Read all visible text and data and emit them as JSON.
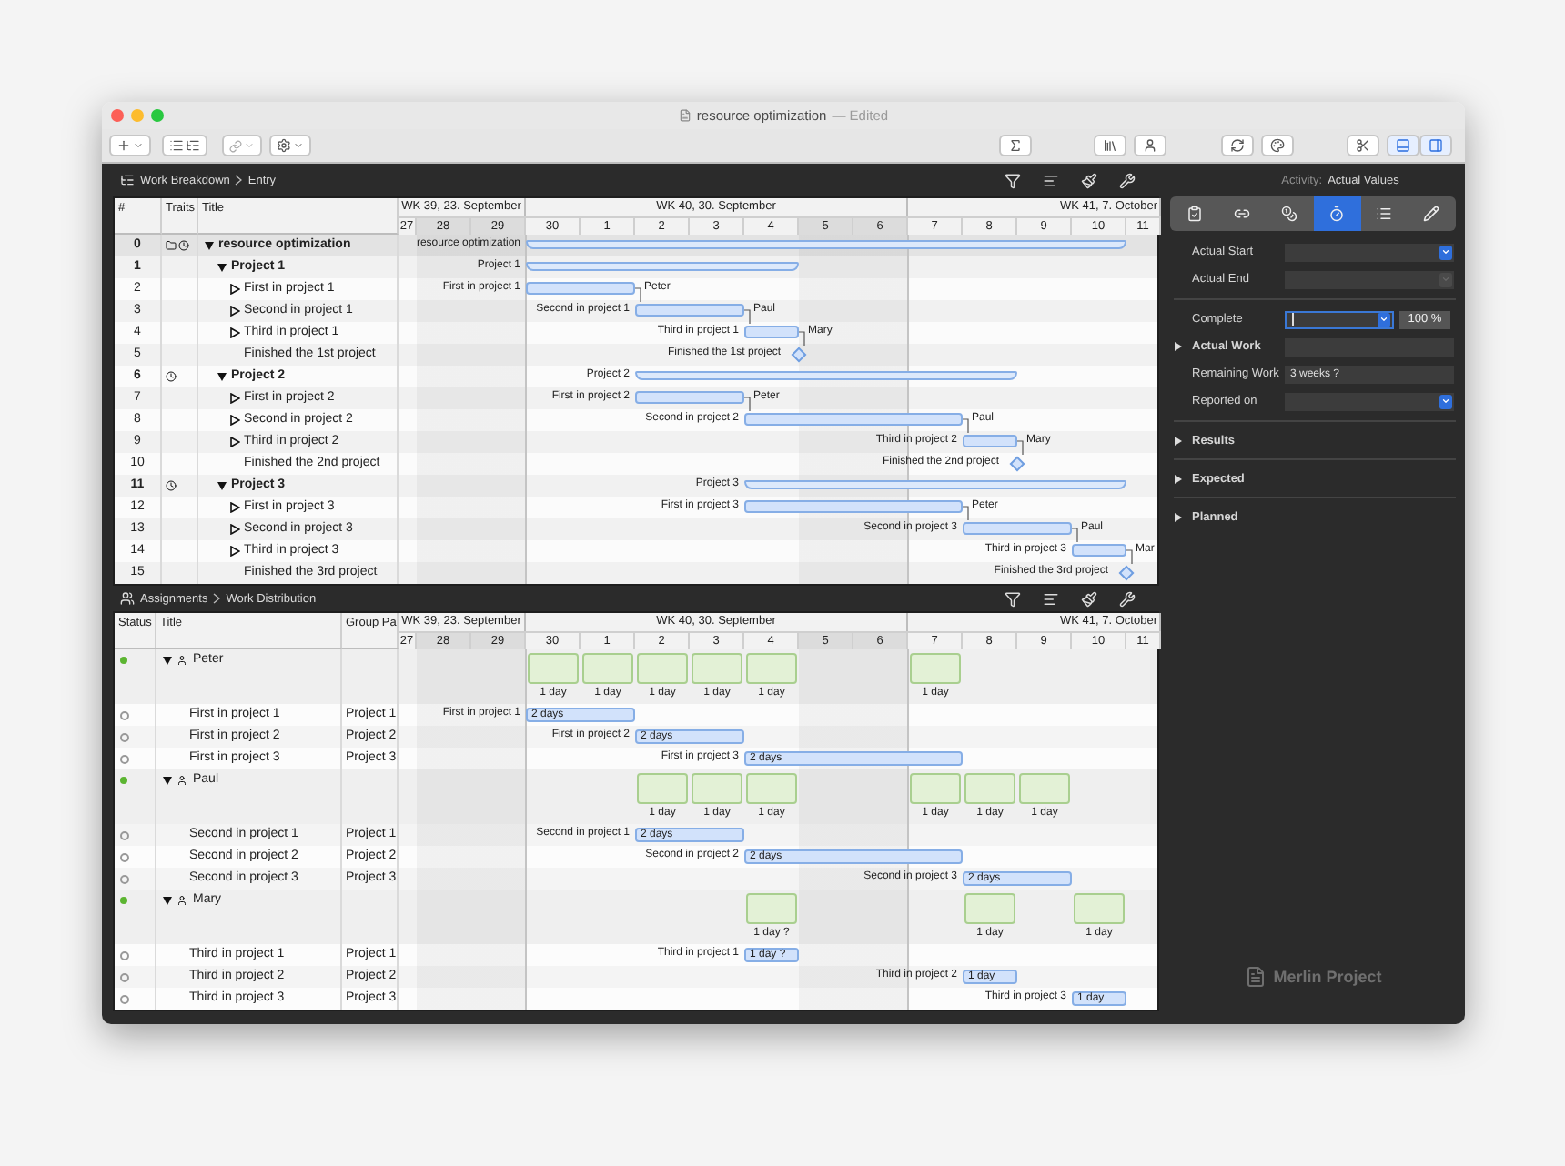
{
  "window": {
    "title": "resource optimization",
    "status": "— Edited"
  },
  "toolbar": {
    "view_toggles": [
      {
        "selected": true
      },
      {
        "selected": true
      }
    ]
  },
  "work_breakdown": {
    "breadcrumb": [
      "Work Breakdown",
      "Entry"
    ],
    "columns": [
      "#",
      "Traits",
      "Title"
    ],
    "weeks": [
      "WK 39, 23. September",
      "WK 40, 30. September",
      "WK 41, 7. October"
    ],
    "days": [
      {
        "label": "27",
        "weekend": false
      },
      {
        "label": "28",
        "weekend": true
      },
      {
        "label": "29",
        "weekend": true
      },
      {
        "label": "30",
        "weekend": false
      },
      {
        "label": "1",
        "weekend": false
      },
      {
        "label": "2",
        "weekend": false
      },
      {
        "label": "3",
        "weekend": false
      },
      {
        "label": "4",
        "weekend": false
      },
      {
        "label": "5",
        "weekend": true
      },
      {
        "label": "6",
        "weekend": true
      },
      {
        "label": "7",
        "weekend": false
      },
      {
        "label": "8",
        "weekend": false
      },
      {
        "label": "9",
        "weekend": false
      },
      {
        "label": "10",
        "weekend": false
      },
      {
        "label": "11",
        "weekend": false
      }
    ],
    "rows": [
      {
        "number": "0",
        "title": "resource optimization",
        "kind": "summary",
        "expanded": true,
        "calendar_trait": true,
        "clock_trait": true,
        "bar_label": "resource optimization",
        "children": [
          {
            "number": "1",
            "title": "Project 1",
            "kind": "summary",
            "expanded": true,
            "calendar_trait": false,
            "clock_trait": false,
            "bar_label": "Project 1",
            "children": [
              {
                "number": "2",
                "title": "First in project 1",
                "kind": "task",
                "expanded": false,
                "bar_label": "First in project 1",
                "resource": "Peter"
              },
              {
                "number": "3",
                "title": "Second in project 1",
                "kind": "task",
                "expanded": false,
                "bar_label": "Second in project 1",
                "resource": "Paul"
              },
              {
                "number": "4",
                "title": "Third in project 1",
                "kind": "task",
                "expanded": false,
                "bar_label": "Third in project 1",
                "resource": "Mary"
              },
              {
                "number": "5",
                "title": "Finished the 1st project",
                "kind": "milestone",
                "bar_label": "Finished the 1st project"
              }
            ]
          },
          {
            "number": "6",
            "title": "Project 2",
            "kind": "summary",
            "expanded": true,
            "calendar_trait": false,
            "clock_trait": true,
            "bar_label": "Project 2",
            "children": [
              {
                "number": "7",
                "title": "First in project 2",
                "kind": "task",
                "expanded": false,
                "bar_label": "First in project 2",
                "resource": "Peter"
              },
              {
                "number": "8",
                "title": "Second in project 2",
                "kind": "task",
                "expanded": false,
                "bar_label": "Second in project 2",
                "resource": "Paul"
              },
              {
                "number": "9",
                "title": "Third in project 2",
                "kind": "task",
                "expanded": false,
                "bar_label": "Third in project 2",
                "resource": "Mary"
              },
              {
                "number": "10",
                "title": "Finished the 2nd project",
                "kind": "milestone",
                "bar_label": "Finished the 2nd project"
              }
            ]
          },
          {
            "number": "11",
            "title": "Project 3",
            "kind": "summary",
            "expanded": true,
            "calendar_trait": false,
            "clock_trait": true,
            "bar_label": "Project 3",
            "children": [
              {
                "number": "12",
                "title": "First in project 3",
                "kind": "task",
                "expanded": false,
                "bar_label": "First in project 3",
                "resource": "Peter"
              },
              {
                "number": "13",
                "title": "Second in project 3",
                "kind": "task",
                "expanded": false,
                "bar_label": "Second in project 3",
                "resource": "Paul"
              },
              {
                "number": "14",
                "title": "Third in project 3",
                "kind": "task",
                "expanded": false,
                "bar_label": "Third in project 3",
                "resource": "Mar"
              },
              {
                "number": "15",
                "title": "Finished the 3rd project",
                "kind": "milestone",
                "bar_label": "Finished the 3rd project"
              }
            ]
          }
        ]
      }
    ]
  },
  "assignments": {
    "breadcrumb": [
      "Assignments",
      "Work Distribution"
    ],
    "columns": [
      "Status",
      "Title",
      "Group Pa"
    ],
    "weeks": [
      "WK 39, 23. September",
      "WK 40, 30. September",
      "WK 41, 7. October"
    ],
    "days": [
      {
        "label": "27",
        "weekend": false
      },
      {
        "label": "28",
        "weekend": true
      },
      {
        "label": "29",
        "weekend": true
      },
      {
        "label": "30",
        "weekend": false
      },
      {
        "label": "1",
        "weekend": false
      },
      {
        "label": "2",
        "weekend": false
      },
      {
        "label": "3",
        "weekend": false
      },
      {
        "label": "4",
        "weekend": false
      },
      {
        "label": "5",
        "weekend": true
      },
      {
        "label": "6",
        "weekend": true
      },
      {
        "label": "7",
        "weekend": false
      },
      {
        "label": "8",
        "weekend": false
      },
      {
        "label": "9",
        "weekend": false
      },
      {
        "label": "10",
        "weekend": false
      },
      {
        "label": "11",
        "weekend": false
      }
    ],
    "rows": [
      {
        "kind": "resource",
        "name": "Peter",
        "color": "#5cb531",
        "expanded": true,
        "loads": [
          "1 day",
          "1 day",
          "1 day",
          "1 day",
          "1 day",
          "1 day"
        ],
        "children": [
          {
            "kind": "assignment",
            "title": "First in project 1",
            "group": "Project 1",
            "bar_label": "First in project 1",
            "bar_text": "2 days"
          },
          {
            "kind": "assignment",
            "title": "First in project 2",
            "group": "Project 2",
            "bar_label": "First in project 2",
            "bar_text": "2 days"
          },
          {
            "kind": "assignment",
            "title": "First in project 3",
            "group": "Project 3",
            "bar_label": "First in project 3",
            "bar_text": "2 days"
          }
        ]
      },
      {
        "kind": "resource",
        "name": "Paul",
        "color": "#5cb531",
        "expanded": true,
        "loads": [
          "1 day",
          "1 day",
          "1 day",
          "1 day",
          "1 day",
          "1 day"
        ],
        "children": [
          {
            "kind": "assignment",
            "title": "Second in project 1",
            "group": "Project 1",
            "bar_label": "Second in project 1",
            "bar_text": "2 days"
          },
          {
            "kind": "assignment",
            "title": "Second in project 2",
            "group": "Project 2",
            "bar_label": "Second in project 2",
            "bar_text": "2 days"
          },
          {
            "kind": "assignment",
            "title": "Second in project 3",
            "group": "Project 3",
            "bar_label": "Second in project 3",
            "bar_text": "2 days"
          }
        ]
      },
      {
        "kind": "resource",
        "name": "Mary",
        "color": "#5cb531",
        "expanded": true,
        "loads": [
          "1 day ?",
          "1 day",
          "1 day"
        ],
        "children": [
          {
            "kind": "assignment",
            "title": "Third in project 1",
            "group": "Project 1",
            "bar_label": "Third in project 1",
            "bar_text": "1 day ?"
          },
          {
            "kind": "assignment",
            "title": "Third in project 2",
            "group": "Project 2",
            "bar_label": "Third in project 2",
            "bar_text": "1 day"
          },
          {
            "kind": "assignment",
            "title": "Third in project 3",
            "group": "Project 3",
            "bar_label": "Third in project 3",
            "bar_text": "1 day"
          }
        ]
      }
    ]
  },
  "inspector": {
    "heading_label": "Activity:",
    "heading_value": "Actual Values",
    "tabs": [
      {
        "selected": false
      },
      {
        "selected": false
      },
      {
        "selected": false
      },
      {
        "selected": true
      },
      {
        "selected": false
      },
      {
        "selected": false
      }
    ],
    "field_groups": [
      [
        {
          "kind": "date",
          "label": "Actual Start",
          "disabled": false
        },
        {
          "kind": "date",
          "label": "Actual End",
          "disabled": true
        }
      ],
      [
        {
          "kind": "percent",
          "label": "Complete",
          "value": "100 %"
        },
        {
          "kind": "group",
          "label": "Actual Work",
          "expanded": false
        },
        {
          "kind": "text",
          "label": "Remaining Work",
          "value": "3 weeks ?"
        },
        {
          "kind": "date",
          "label": "Reported on",
          "disabled": false
        }
      ]
    ],
    "sections": [
      {
        "label": "Results",
        "expanded": false
      },
      {
        "label": "Expected",
        "expanded": false
      },
      {
        "label": "Planned",
        "expanded": false
      }
    ],
    "logo": "Merlin Project"
  }
}
